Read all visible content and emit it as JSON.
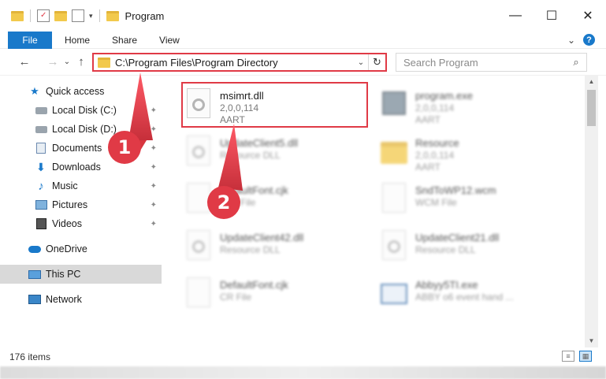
{
  "window": {
    "title": "Program",
    "minimize_glyph": "—",
    "maximize_glyph": "☐",
    "close_glyph": "✕"
  },
  "ribbon": {
    "tabs": [
      "File",
      "Home",
      "Share",
      "View"
    ],
    "help_glyph": "?",
    "expand_glyph": "⌄"
  },
  "navigation": {
    "back_glyph": "←",
    "forward_glyph": "→",
    "history_glyph": "⌄",
    "up_glyph": "↑",
    "address": "C:\\Program Files\\Program Directory",
    "dropdown_glyph": "⌄",
    "refresh_glyph": "↻",
    "search_placeholder": "Search Program",
    "search_glyph": "⌕"
  },
  "sidebar": {
    "items": [
      {
        "label": "Quick access",
        "icon": "star-icon",
        "pinned": false
      },
      {
        "label": "Local Disk (C:)",
        "icon": "drive-icon",
        "pinned": true
      },
      {
        "label": "Local Disk (D:)",
        "icon": "drive-icon",
        "pinned": true
      },
      {
        "label": "Documents",
        "icon": "documents-icon",
        "pinned": true
      },
      {
        "label": "Downloads",
        "icon": "downloads-icon",
        "pinned": true
      },
      {
        "label": "Music",
        "icon": "music-icon",
        "pinned": true
      },
      {
        "label": "Pictures",
        "icon": "pictures-icon",
        "pinned": true
      },
      {
        "label": "Videos",
        "icon": "videos-icon",
        "pinned": true
      },
      {
        "label": "OneDrive",
        "icon": "onedrive-icon",
        "pinned": false
      },
      {
        "label": "This PC",
        "icon": "this-pc-icon",
        "pinned": false,
        "selected": true
      },
      {
        "label": "Network",
        "icon": "network-icon",
        "pinned": false
      }
    ],
    "pin_glyph": "📌"
  },
  "files": [
    {
      "name": "msimrt.dll",
      "line2": "2,0,0,114",
      "line3": "AART",
      "icon": "dll-icon",
      "highlighted": true
    },
    {
      "name": "program.exe",
      "line2": "2,0,0,114",
      "line3": "AART",
      "icon": "exe-icon"
    },
    {
      "name": "UpdateClient5.dll",
      "line2": "Resource DLL",
      "line3": "",
      "icon": "dll-icon"
    },
    {
      "name": "Resource",
      "line2": "2,0,0,114",
      "line3": "AART",
      "icon": "folder-icon"
    },
    {
      "name": "DefaultFont.cjk",
      "line2": "CJK File",
      "line3": "",
      "icon": "file-icon"
    },
    {
      "name": "SndToWP12.wcm",
      "line2": "WCM File",
      "line3": "",
      "icon": "file-icon"
    },
    {
      "name": "UpdateClient42.dll",
      "line2": "Resource DLL",
      "line3": "",
      "icon": "dll-icon"
    },
    {
      "name": "UpdateClient21.dll",
      "line2": "Resource DLL",
      "line3": "",
      "icon": "dll-icon"
    },
    {
      "name": "DefaultFont.cjk",
      "line2": "CR File",
      "line3": "",
      "icon": "file-icon"
    },
    {
      "name": "Abbyy5TI.exe",
      "line2": "ABBY o6 event hand ...",
      "line3": "",
      "icon": "window-icon"
    }
  ],
  "status": {
    "item_count": "176 items"
  },
  "callouts": [
    "1",
    "2"
  ],
  "colors": {
    "accent": "#1979ca",
    "highlight": "#e03a46"
  }
}
